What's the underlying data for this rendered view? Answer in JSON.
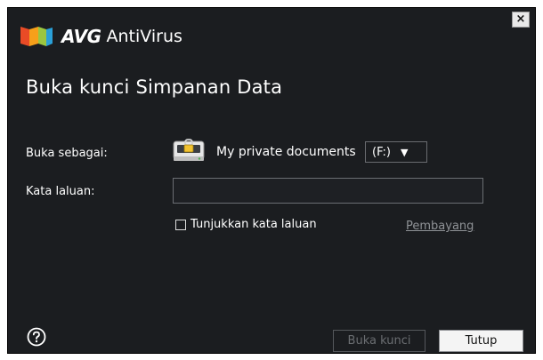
{
  "window": {
    "close_label": "×"
  },
  "brand": {
    "logo_text": "AVG",
    "product_name": "AntiVirus",
    "logo_colors": [
      "#e94b26",
      "#f6a01a",
      "#9bc640",
      "#2aa0d8"
    ]
  },
  "dialog": {
    "title": "Buka kunci Simpanan Data"
  },
  "form": {
    "open_as_label": "Buka sebagai:",
    "vault_icon": "vault-drive-icon",
    "vault_name": "My private documents",
    "drive_value": "(F:)",
    "drive_arrow": "▼",
    "password_label": "Kata laluan:",
    "password_value": "",
    "show_password_label": "Tunjukkan kata laluan",
    "show_password_checked": false,
    "generator_link": "Pembayang"
  },
  "footer": {
    "help_icon": "question-circle-icon",
    "unlock_label": "Buka kunci",
    "close_label": "Tutup"
  }
}
